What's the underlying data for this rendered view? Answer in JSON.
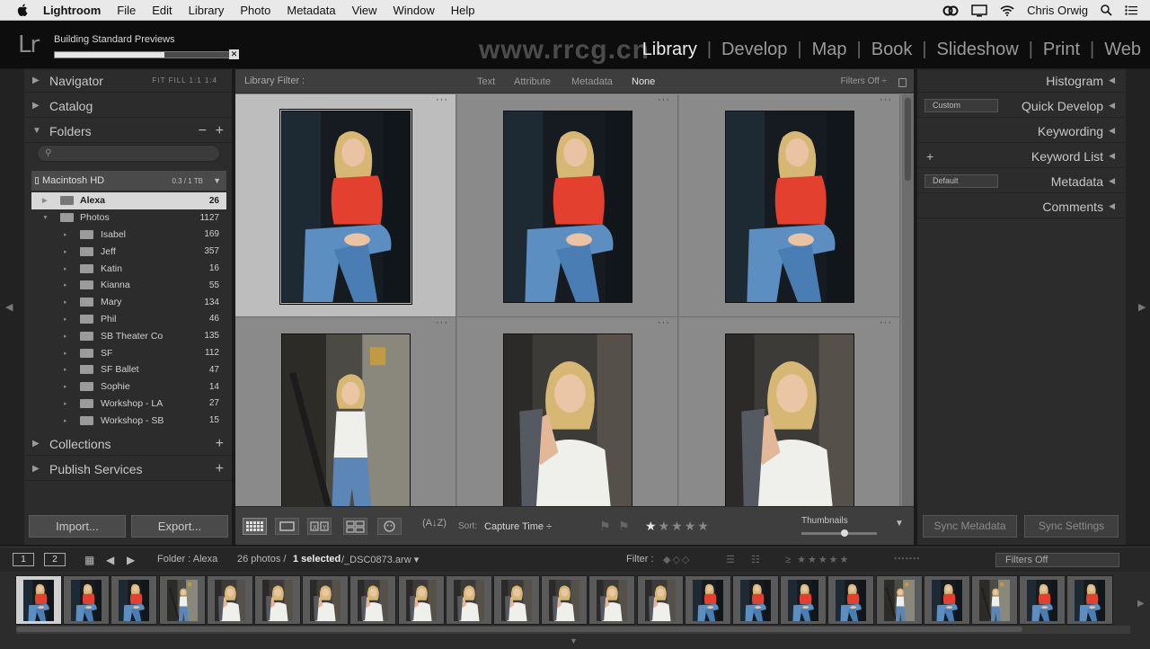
{
  "menubar": {
    "app": "Lightroom",
    "items": [
      "File",
      "Edit",
      "Library",
      "Photo",
      "Metadata",
      "View",
      "Window",
      "Help"
    ],
    "user": "Chris Orwig"
  },
  "topbar": {
    "logo": "Lr",
    "progress_label": "Building Standard Previews",
    "progress_value": 0.6,
    "modules": [
      "Library",
      "Develop",
      "Map",
      "Book",
      "Slideshow",
      "Print",
      "Web"
    ],
    "active_module": "Library",
    "watermark": "www.rrcg.cn"
  },
  "left_panel": {
    "navigator": {
      "label": "Navigator",
      "zoom_options": "FIT  FILL  1:1  1:4"
    },
    "catalog": {
      "label": "Catalog"
    },
    "folders": {
      "label": "Folders",
      "minus": "−",
      "plus": "+"
    },
    "volume": {
      "name": "Macintosh HD",
      "size": "0.3 / 1 TB"
    },
    "tree": [
      {
        "name": "Alexa",
        "count": "26",
        "level": 0,
        "selected": true
      },
      {
        "name": "Photos",
        "count": "1127",
        "level": 0,
        "selected": false
      },
      {
        "name": "Isabel",
        "count": "169",
        "level": 1
      },
      {
        "name": "Jeff",
        "count": "357",
        "level": 1
      },
      {
        "name": "Katin",
        "count": "16",
        "level": 1
      },
      {
        "name": "Kianna",
        "count": "55",
        "level": 1
      },
      {
        "name": "Mary",
        "count": "134",
        "level": 1
      },
      {
        "name": "Phil",
        "count": "46",
        "level": 1
      },
      {
        "name": "SB Theater Co",
        "count": "135",
        "level": 1
      },
      {
        "name": "SF",
        "count": "112",
        "level": 1
      },
      {
        "name": "SF Ballet",
        "count": "47",
        "level": 1
      },
      {
        "name": "Sophie",
        "count": "14",
        "level": 1
      },
      {
        "name": "Workshop - LA",
        "count": "27",
        "level": 1
      },
      {
        "name": "Workshop - SB",
        "count": "15",
        "level": 1
      }
    ],
    "collections": {
      "label": "Collections",
      "plus": "+"
    },
    "publish": {
      "label": "Publish Services",
      "plus": "+"
    },
    "import_label": "Import...",
    "export_label": "Export..."
  },
  "library_filter": {
    "title": "Library Filter :",
    "options": [
      "Text",
      "Attribute",
      "Metadata",
      "None"
    ],
    "active": "None",
    "filters_off": "Filters Off ÷"
  },
  "grid": {
    "dots": "···"
  },
  "toolbar": {
    "sort_label": "Sort:",
    "sort_value": "Capture Time ÷",
    "rating_stars": "★★★★★",
    "thumbnails_label": "Thumbnails",
    "thumbnail_size": 0.55
  },
  "right_panel": {
    "histogram": "Histogram",
    "quick_develop": "Quick Develop",
    "quick_develop_preset": "Custom",
    "keywording": "Keywording",
    "keyword_list": "Keyword List",
    "keyword_plus": "+",
    "metadata": "Metadata",
    "metadata_preset": "Default",
    "comments": "Comments",
    "sync_metadata": "Sync Metadata",
    "sync_settings": "Sync Settings"
  },
  "filmstrip_bar": {
    "monitor1": "1",
    "monitor2": "2",
    "folder": "Folder : Alexa",
    "count_prefix": "26 photos /",
    "count_selected": "1 selected",
    "filename": "/_DSC0873.arw ▾",
    "filter_label": "Filter :",
    "rating_filter": "≥ ★★★★★",
    "filters_off": "Filters Off"
  },
  "colors": {
    "accent_red": "#e3402f",
    "panel": "#2c2c2c",
    "grid_bg": "#7e7e7e",
    "selected_cell": "#bdbdbd"
  }
}
